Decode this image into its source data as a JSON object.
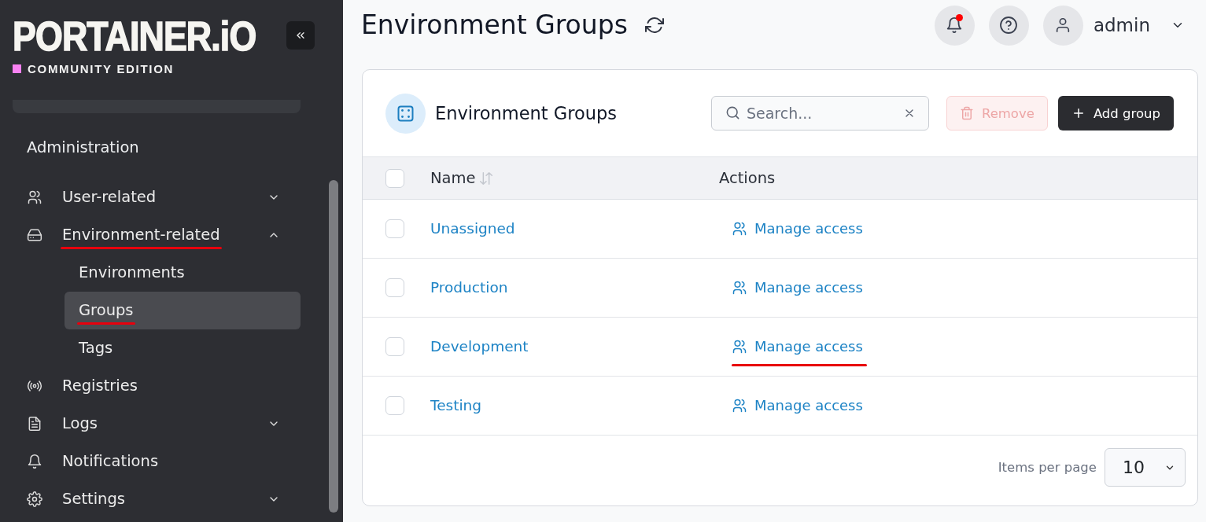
{
  "sidebar": {
    "logo": "PORTAINER.iO",
    "edition": "COMMUNITY EDITION",
    "section": "Administration",
    "items": [
      {
        "label": "User-related",
        "kind": "group",
        "expanded": false,
        "selected": false,
        "annotated": false
      },
      {
        "label": "Environment-related",
        "kind": "group",
        "expanded": true,
        "selected": false,
        "annotated": true,
        "children": [
          {
            "label": "Environments",
            "selected": false,
            "annotated": false
          },
          {
            "label": "Groups",
            "selected": true,
            "annotated": true
          },
          {
            "label": "Tags",
            "selected": false,
            "annotated": false
          }
        ]
      },
      {
        "label": "Registries",
        "kind": "link",
        "selected": false,
        "annotated": false
      },
      {
        "label": "Logs",
        "kind": "group",
        "expanded": false,
        "selected": false,
        "annotated": false
      },
      {
        "label": "Notifications",
        "kind": "link",
        "selected": false,
        "annotated": false
      },
      {
        "label": "Settings",
        "kind": "group",
        "expanded": false,
        "selected": false,
        "annotated": false
      }
    ]
  },
  "header": {
    "title": "Environment Groups",
    "notifications_unread": true,
    "user": "admin"
  },
  "card": {
    "title": "Environment Groups",
    "search": {
      "placeholder": "Search..."
    },
    "buttons": [
      {
        "label": "Remove",
        "kind": "danger",
        "disabled": true
      },
      {
        "label": "Add group",
        "kind": "primary",
        "disabled": false
      }
    ],
    "table": {
      "all_checked": false,
      "columns": [
        {
          "label": "Name",
          "sortable": true
        },
        {
          "label": "Actions",
          "sortable": false
        }
      ],
      "rows": [
        {
          "name": "Unassigned",
          "action": "Manage access",
          "checked": false,
          "annotated": false
        },
        {
          "name": "Production",
          "action": "Manage access",
          "checked": false,
          "annotated": false
        },
        {
          "name": "Development",
          "action": "Manage access",
          "checked": false,
          "annotated": true
        },
        {
          "name": "Testing",
          "action": "Manage access",
          "checked": false,
          "annotated": false
        }
      ]
    },
    "footer": {
      "label": "Items per page",
      "page_size": "10"
    }
  }
}
